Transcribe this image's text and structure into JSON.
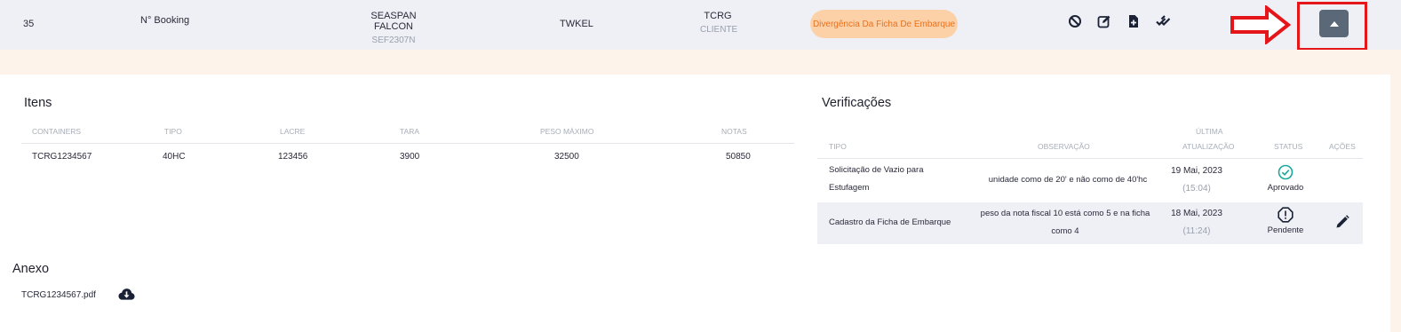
{
  "booking": {
    "id": "35",
    "label": "N° Booking",
    "vessel": "SEASPAN FALCON",
    "voyage": "SEF2307N",
    "code": "TWKEL",
    "terminal": "TCRG",
    "terminal_sub": "CLIENTE",
    "status_badge": "Divergência Da Ficha De Embarque",
    "actions": [
      "cancel-icon",
      "edit-icon",
      "add-file-icon",
      "double-check-icon"
    ]
  },
  "colors": {
    "accent_badge_bg": "#fcd1a8",
    "accent_badge_text": "#e9711f",
    "approved": "#1aa89a",
    "highlight_red": "#e5161a",
    "collapse_button": "#5b6878"
  },
  "items": {
    "title": "Itens",
    "columns": [
      "CONTAINERS",
      "TIPO",
      "LACRE",
      "TARA",
      "PESO MÁXIMO",
      "NOTAS"
    ],
    "rows": [
      [
        "TCRG1234567",
        "40HC",
        "123456",
        "3900",
        "32500",
        "50850"
      ]
    ]
  },
  "verifications": {
    "title": "Verificações",
    "columns": {
      "type": "TIPO",
      "observation": "OBSERVAÇÃO",
      "last_update_1": "ÚLTIMA",
      "last_update_2": "ATUALIZAÇÃO",
      "status": "STATUS",
      "actions": "AÇÕES"
    },
    "rows": [
      {
        "type_1": "Solicitação de Vazio para",
        "type_2": "Estufagem",
        "observation_1": "unidade como de 20' e não como de 40'hc",
        "observation_2": "",
        "date": "19 Mai, 2023",
        "time": "(15:04)",
        "status": "Aprovado",
        "status_icon": "check-circle-icon"
      },
      {
        "type_1": "Cadastro da Ficha de Embarque",
        "type_2": "",
        "observation_1": "peso da nota fiscal 10 está como 5 e na ficha",
        "observation_2": "como 4",
        "date": "18 Mai, 2023",
        "time": "(11:24)",
        "status": "Pendente",
        "status_icon": "alert-octagon-icon",
        "action_icon": "pencil-icon"
      }
    ]
  },
  "attachment": {
    "title": "Anexo",
    "file": "TCRG1234567.pdf",
    "icon": "cloud-download-icon"
  }
}
